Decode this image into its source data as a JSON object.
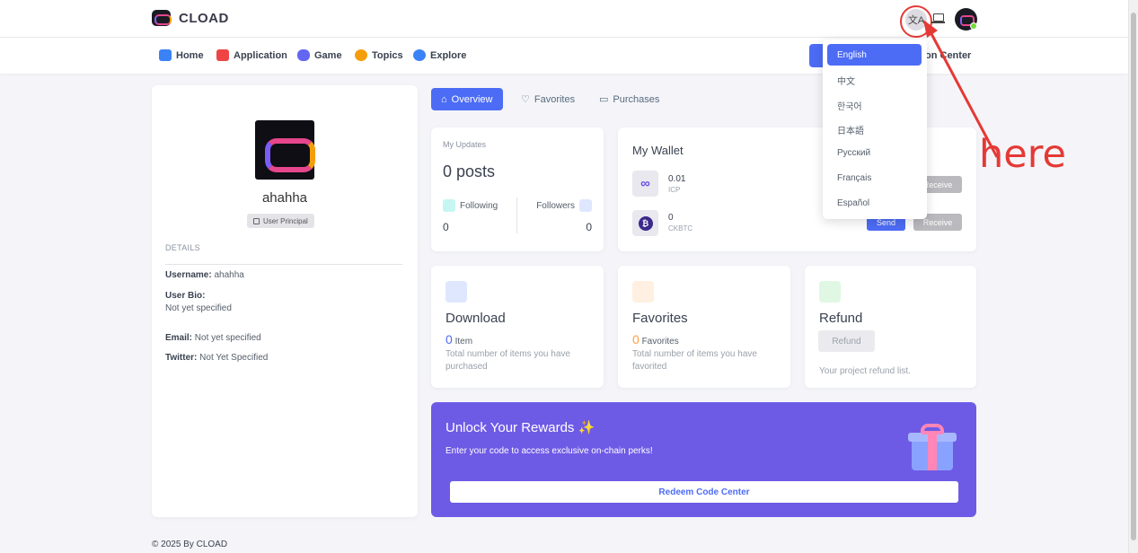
{
  "brand": {
    "name": "CLOAD"
  },
  "nav": {
    "items": [
      {
        "label": "Home",
        "icon": "home-icon",
        "color": "#3b82f6"
      },
      {
        "label": "Application",
        "icon": "grid-icon",
        "color": "#ef4444"
      },
      {
        "label": "Game",
        "icon": "gamepad-icon",
        "color": "#6366f1"
      },
      {
        "label": "Topics",
        "icon": "bulb-icon",
        "color": "#f59e0b"
      },
      {
        "label": "Explore",
        "icon": "compass-icon",
        "color": "#3b82f6"
      }
    ],
    "right_label": "on Center"
  },
  "profile": {
    "name": "ahahha",
    "principal_label": "User Principal",
    "details_heading": "DETAILS",
    "username_label": "Username:",
    "username_value": "ahahha",
    "bio_label": "User Bio:",
    "bio_value": "Not yet specified",
    "email_label": "Email:",
    "email_value": "Not yet specified",
    "twitter_label": "Twitter:",
    "twitter_value": "Not Yet Specified"
  },
  "tabs": [
    {
      "label": "Overview",
      "active": true
    },
    {
      "label": "Favorites",
      "active": false
    },
    {
      "label": "Purchases",
      "active": false
    }
  ],
  "updates": {
    "label": "My Updates",
    "posts": "0 posts",
    "following_label": "Following",
    "following_value": "0",
    "followers_label": "Followers",
    "followers_value": "0"
  },
  "wallet": {
    "title": "My Wallet",
    "coins": [
      {
        "amount": "0.01",
        "symbol": "ICP",
        "receive": "Receive"
      },
      {
        "amount": "0",
        "symbol": "CKBTC",
        "send": "Send",
        "receive": "Receive"
      }
    ]
  },
  "download": {
    "title": "Download",
    "count": "0",
    "unit": "Item",
    "desc": "Total number of items you have purchased"
  },
  "favorites": {
    "title": "Favorites",
    "count": "0",
    "unit": "Favorites",
    "desc": "Total number of items you have favorited"
  },
  "refund": {
    "title": "Refund",
    "button": "Refund",
    "desc": "Your project refund list."
  },
  "rewards": {
    "title": "Unlock Your Rewards",
    "title_emoji": "✨",
    "subtitle": "Enter your code to access exclusive on-chain perks!",
    "button": "Redeem Code Center"
  },
  "language_menu": {
    "options": [
      "English",
      "中文",
      "한국어",
      "日本語",
      "Русский",
      "Français",
      "Español"
    ],
    "selected": "English"
  },
  "annotation": {
    "text": "here"
  },
  "footer": {
    "text": "© 2025 By CLOAD"
  }
}
